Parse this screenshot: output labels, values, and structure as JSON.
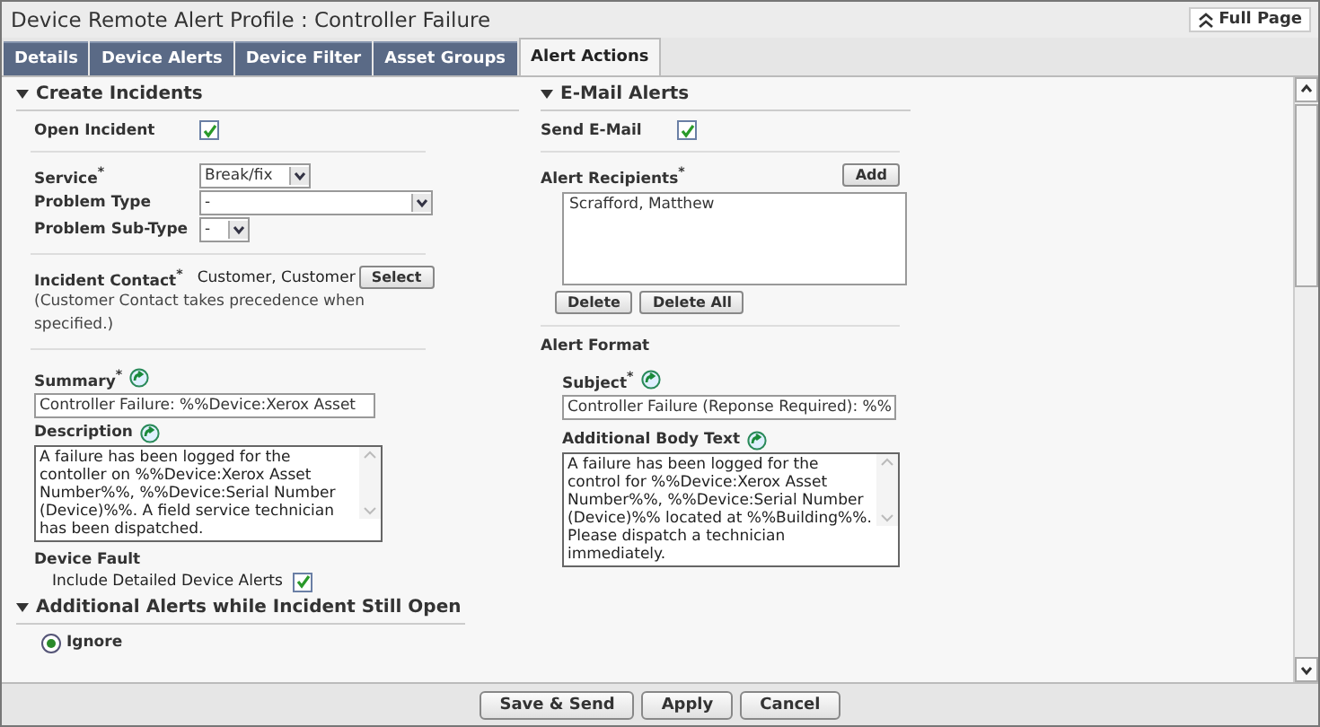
{
  "window": {
    "title": "Device Remote Alert Profile : Controller Failure",
    "full_page_button": "Full Page"
  },
  "tabs": [
    {
      "label": "Details",
      "selected": false
    },
    {
      "label": "Device Alerts",
      "selected": false
    },
    {
      "label": "Device Filter",
      "selected": false
    },
    {
      "label": "Asset Groups",
      "selected": false
    },
    {
      "label": "Alert Actions",
      "selected": true
    }
  ],
  "create_incidents": {
    "heading": "Create Incidents",
    "expanded": true,
    "open_incident": {
      "label": "Open Incident",
      "checked": true
    },
    "service": {
      "label": "Service$^{*}$",
      "value": "Break/fix"
    },
    "problem_type": {
      "label": "Problem Type",
      "value": "-"
    },
    "problem_sub_type": {
      "label": "Problem Sub-Type",
      "value": "-"
    },
    "incident_contact": {
      "label": "Incident Contact$^{*}$",
      "value": "Customer, Customer",
      "button": "Select",
      "note": "(Customer Contact takes precedence when specified.)"
    },
    "summary": {
      "label": "Summary$^{*}$",
      "value": "Controller Failure: %%Device:Xerox Asset"
    },
    "description": {
      "label": "Description",
      "value": "A failure has been logged for the contoller on %%Device:Xerox Asset Number%%, %%Device:Serial Number (Device)%%.  A field service technician has been dispatched."
    },
    "device_fault": {
      "label": "Device Fault",
      "option": {
        "label": "Include Detailed Device Alerts",
        "checked": true
      }
    }
  },
  "additional_alerts": {
    "heading": "Additional Alerts while Incident Still Open",
    "expanded": true,
    "options": [
      {
        "label": "Ignore",
        "selected": true
      }
    ]
  },
  "email_alerts": {
    "heading": "E-Mail Alerts",
    "expanded": true,
    "send_email": {
      "label": "Send E-Mail",
      "checked": true
    },
    "recipients": {
      "label": "Alert Recipients$^{*}$",
      "add_button": "Add",
      "items": [
        "Scrafford, Matthew"
      ],
      "buttons": [
        "Delete",
        "Delete All"
      ]
    },
    "alert_format": {
      "heading": "Alert Format",
      "subject": {
        "label": "Subject$^{*}$",
        "value": "Controller Failure (Reponse Required): %%"
      },
      "body": {
        "label": "Additional Body Text",
        "value": "A failure has been logged for the control for %%Device:Xerox Asset Number%%, %%Device:Serial Number (Device)%% located at %%Building%%.  Please dispatch a technician immediately."
      }
    }
  },
  "footer_buttons": [
    "Save & Send",
    "Apply",
    "Cancel"
  ]
}
